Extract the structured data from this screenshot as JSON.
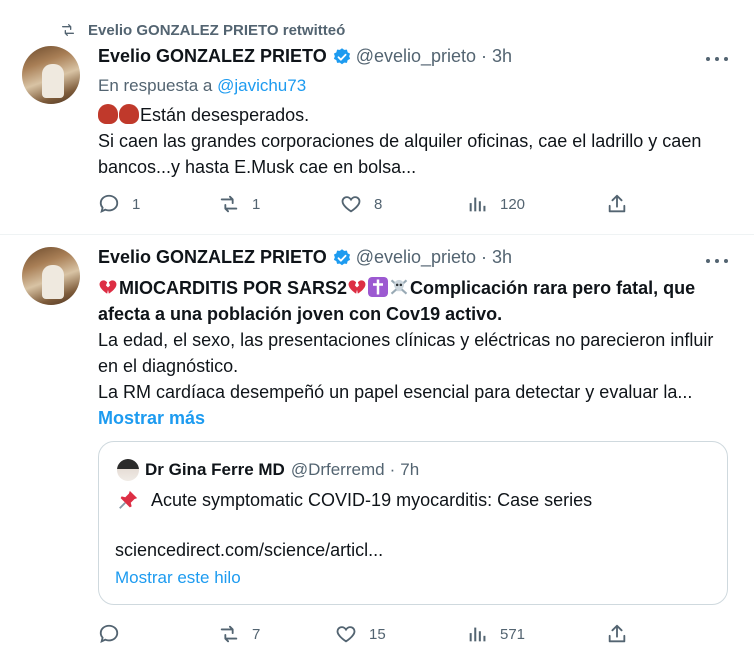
{
  "retweet_banner": {
    "text": "Evelio GONZALEZ PRIETO retwitteó"
  },
  "tweet1": {
    "name": "Evelio GONZALEZ PRIETO",
    "handle": "@evelio_prieto",
    "dot": "·",
    "time": "3h",
    "reply_prefix": "En respuesta a ",
    "reply_handle": "@javichu73",
    "line1": "Están desesperados.",
    "line2": "Si caen las grandes corporaciones de alquiler oficinas, cae el ladrillo y caen bancos...y hasta E.Musk cae en bolsa...",
    "actions": {
      "replies": "1",
      "retweets": "1",
      "likes": "8",
      "views": "120"
    }
  },
  "tweet2": {
    "name": "Evelio GONZALEZ PRIETO",
    "handle": "@evelio_prieto",
    "dot": "·",
    "time": "3h",
    "headline_a": "MIOCARDITIS POR SARS2",
    "headline_b": "Complicación rara pero fatal, que afecta a una población joven con Cov19 activo.",
    "para1": "La edad, el sexo, las presentaciones clínicas y eléctricas no parecieron influir en el diagnóstico.",
    "para2": "La RM cardíaca desempeñó un papel esencial para detectar y evaluar la...",
    "show_more": "Mostrar más",
    "quote": {
      "name": "Dr Gina Ferre MD",
      "handle": "@Drferremd",
      "dot": "·",
      "time": "7h",
      "text": "Acute symptomatic COVID-19 myocarditis: Case series",
      "link": "sciencedirect.com/science/articl...",
      "thread": "Mostrar este hilo"
    },
    "actions": {
      "replies": "",
      "retweets": "7",
      "likes": "15",
      "views": "571"
    }
  },
  "colors": {
    "accent": "#1d9bf0",
    "muted": "#536471",
    "text": "#0f1419",
    "border": "#cfd9de"
  },
  "icons": [
    "retweet-icon",
    "verified-badge-icon",
    "more-icon",
    "reply-icon",
    "like-icon",
    "views-icon",
    "share-icon",
    "pin-icon",
    "broken-heart-icon",
    "latin-cross-icon",
    "skull-crossbones-icon",
    "goblin-icon"
  ]
}
